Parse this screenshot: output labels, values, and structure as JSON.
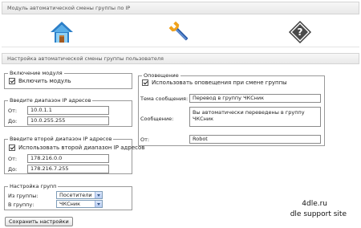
{
  "header": {
    "title": "Модуль автоматической смены группы по IP"
  },
  "nav": [
    {
      "icon": "home-icon"
    },
    {
      "icon": "wrench-icon"
    },
    {
      "icon": "help-icon"
    }
  ],
  "section": {
    "title": "Настройка автоматической смены группы пользователя"
  },
  "module_enable": {
    "legend": "Включение модуля",
    "checkbox_label": "Включить модуль",
    "checked": true
  },
  "ip_range": {
    "legend": "Введите диапазон IP адресов",
    "from_label": "От:",
    "from_value": "10.0.1.1",
    "to_label": "До:",
    "to_value": "10.0.255.255"
  },
  "ip_range2": {
    "legend": "Введите второй диапазон IP адресов",
    "checkbox_label": "Использовать второй диапазон IP адресов",
    "checked": true,
    "from_label": "От:",
    "from_value": "178.216.0.0",
    "to_label": "До:",
    "to_value": "178.216.7.255"
  },
  "groups": {
    "legend": "Настройка групп",
    "from_label": "Из группы:",
    "from_value": "Посетители",
    "to_label": "В группу:",
    "to_value": "ЧКСник"
  },
  "notify": {
    "legend": "Оповещение",
    "checkbox_label": "Использовать оповещения при смене группы",
    "checked": true,
    "subject_label": "Тема сообщения:",
    "subject_value": "Перевод в группу ЧКСник",
    "message_label": "Сообщение:",
    "message_value": "Вы автоматически переведены в группу ЧКСник",
    "from_label": "От:",
    "from_value": "Robot"
  },
  "save_label": "Сохранить настройки",
  "brand": {
    "line1": "4dle.ru",
    "line2": "dle support site"
  }
}
